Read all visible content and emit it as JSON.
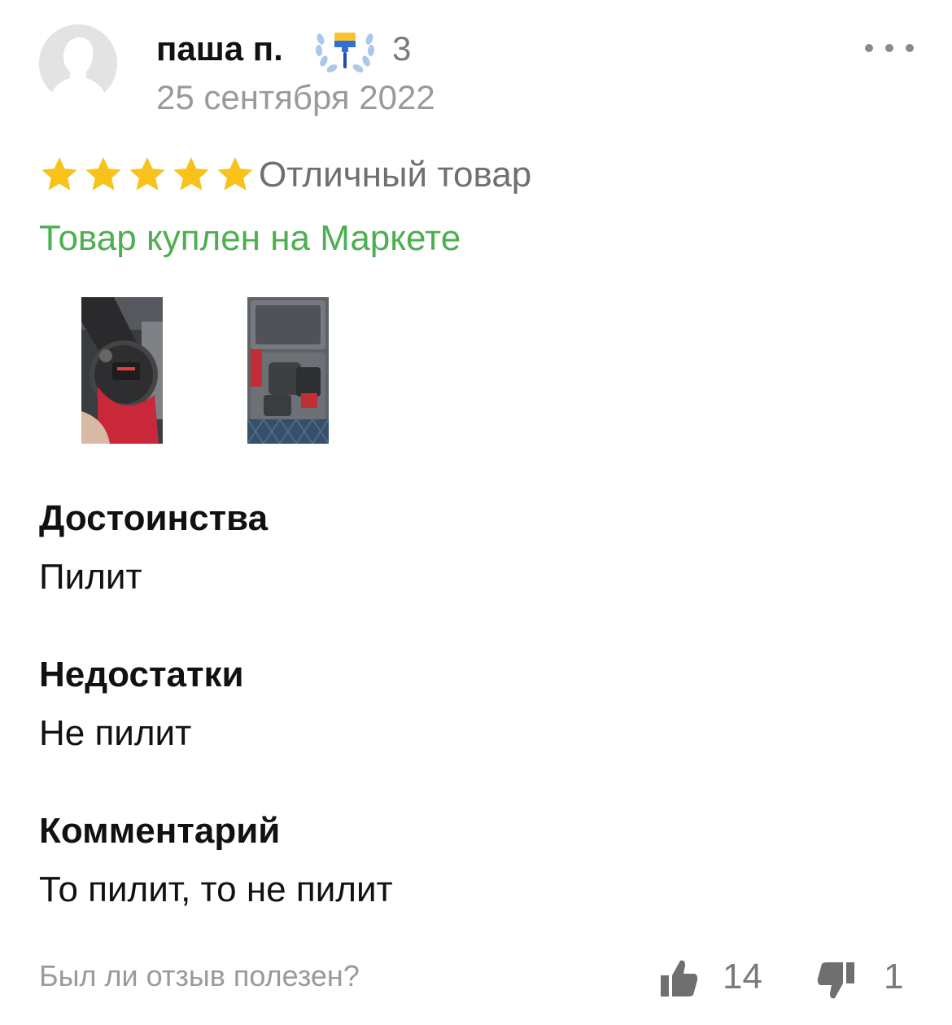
{
  "review": {
    "author": {
      "name": "паша п.",
      "level": "3",
      "avatar_icon": "user-silhouette-icon",
      "badge_icon": "paint-brush-laurel-icon"
    },
    "date": "25 сентября 2022",
    "rating": {
      "stars": 5,
      "max": 5,
      "label": "Отличный товар",
      "star_color": "#f7c31b"
    },
    "verified_purchase": "Товар куплен на Маркете",
    "photos": [
      "photo-chainsaw-in-hand",
      "photo-chainsaw-case"
    ],
    "sections": [
      {
        "title": "Достоинства",
        "text": "Пилит"
      },
      {
        "title": "Недостатки",
        "text": "Не пилит"
      },
      {
        "title": "Комментарий",
        "text": "То пилит, то не пилит"
      }
    ],
    "helpful_question": "Был ли отзыв полезен?",
    "votes": {
      "likes": "14",
      "dislikes": "1"
    }
  },
  "colors": {
    "accent_green": "#4caf50",
    "muted_text": "#9a9a9a",
    "icon_gray": "#6f6f6f"
  }
}
